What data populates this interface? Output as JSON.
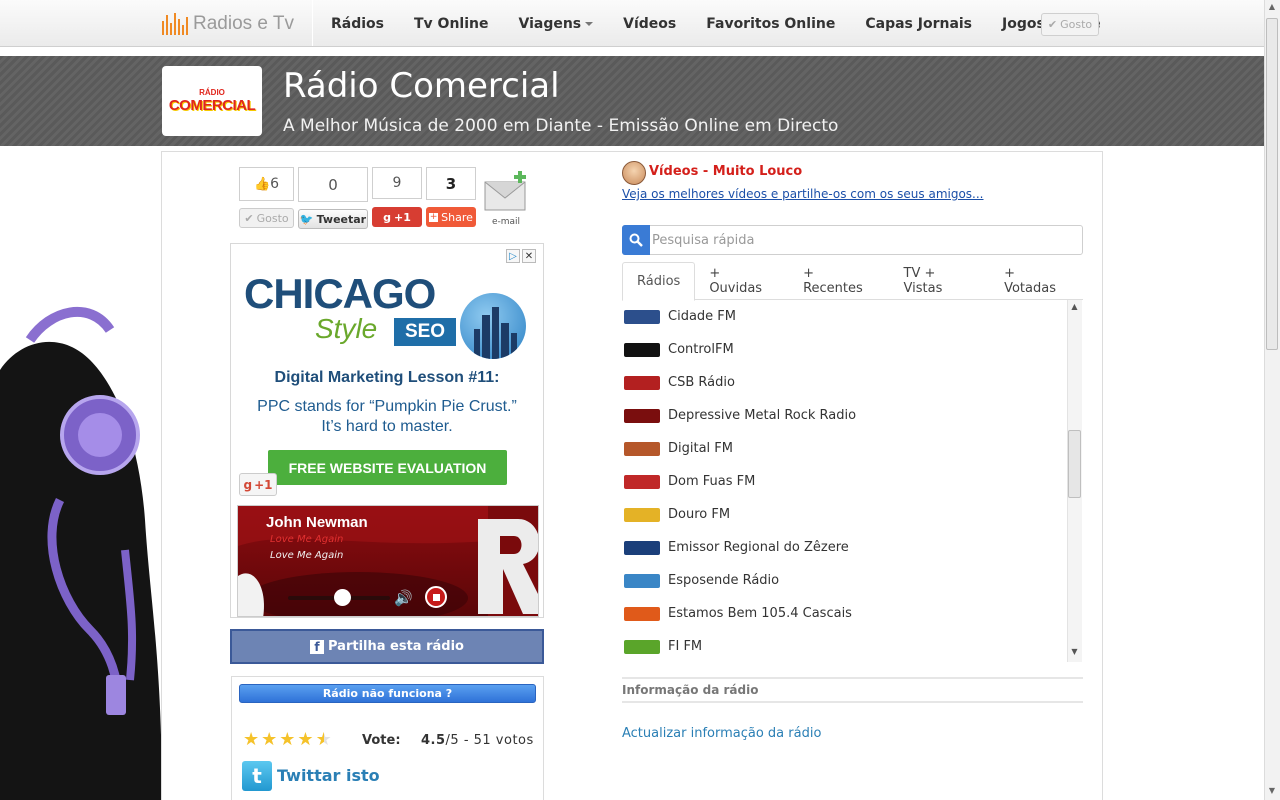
{
  "nav": {
    "brand": "Radios e Tv",
    "items": [
      {
        "label": "Rádios"
      },
      {
        "label": "Tv Online"
      },
      {
        "label": "Viagens"
      },
      {
        "label": "Vídeos"
      },
      {
        "label": "Favoritos Online"
      },
      {
        "label": "Capas Jornais"
      },
      {
        "label": "Jogos Online"
      }
    ],
    "like_button": "Gosto"
  },
  "header": {
    "logo_small": "RÁDIO",
    "logo_big": "COMERCIAL",
    "title": "Rádio Comercial",
    "subtitle": "A Melhor Música de 2000 em Diante - Emissão Online em Directo"
  },
  "social": {
    "fb_like_count": "6",
    "fb_like_label": "Gosto",
    "tweet_count": "0",
    "tweet_label": "Tweetar",
    "gplus_count": "9",
    "gplus_label": "+1",
    "share_count": "3",
    "share_label": "Share",
    "email_label": "e-mail"
  },
  "ad": {
    "brand": "CHICAGO",
    "style": "Style",
    "seo": "SEO",
    "heading": "Digital Marketing Lesson #11:",
    "text1": "PPC stands for “Pumpkin Pie Crust.”",
    "text2": "It’s hard to master.",
    "cta": "FREE WEBSITE EVALUATION",
    "gplus": "+1"
  },
  "player": {
    "artist": "John Newman",
    "song_red": "Love Me Again",
    "song_white": "Love Me Again",
    "progress": 0.5
  },
  "share_fb": "Partilha esta rádio",
  "report_button": "Rádio não funciona ?",
  "rating": {
    "stars": 4.5,
    "label": "Vote:",
    "score": "4.5",
    "suffix": "/5 - 51 votos"
  },
  "twitter_share": "Twittar isto",
  "videos": {
    "title": "Vídeos - Muito Louco",
    "link": "Veja os melhores vídeos e partilhe-os com os seus amigos..."
  },
  "search": {
    "placeholder": "Pesquisa rápida"
  },
  "tabs": [
    {
      "label": "Rádios"
    },
    {
      "label": "+ Ouvidas"
    },
    {
      "label": "+ Recentes"
    },
    {
      "label": "TV + Vistas"
    },
    {
      "label": "+ Votadas"
    }
  ],
  "stations": [
    {
      "name": "Cidade FM",
      "color": "#2c4f8c"
    },
    {
      "name": "ControlFM",
      "color": "#111111"
    },
    {
      "name": "CSB Rádio",
      "color": "#b32020"
    },
    {
      "name": "Depressive Metal Rock Radio",
      "color": "#7a0e0e"
    },
    {
      "name": "Digital FM",
      "color": "#b5572a"
    },
    {
      "name": "Dom Fuas FM",
      "color": "#c02828"
    },
    {
      "name": "Douro FM",
      "color": "#e4b226"
    },
    {
      "name": "Emissor Regional do Zêzere",
      "color": "#1b3f7a"
    },
    {
      "name": "Esposende Rádio",
      "color": "#3a86c6"
    },
    {
      "name": "Estamos Bem 105.4 Cascais",
      "color": "#e05a1a"
    },
    {
      "name": "FI FM",
      "color": "#5aa52a"
    }
  ],
  "info_section": "Informação da rádio",
  "update_link": "Actualizar informação da rádio"
}
